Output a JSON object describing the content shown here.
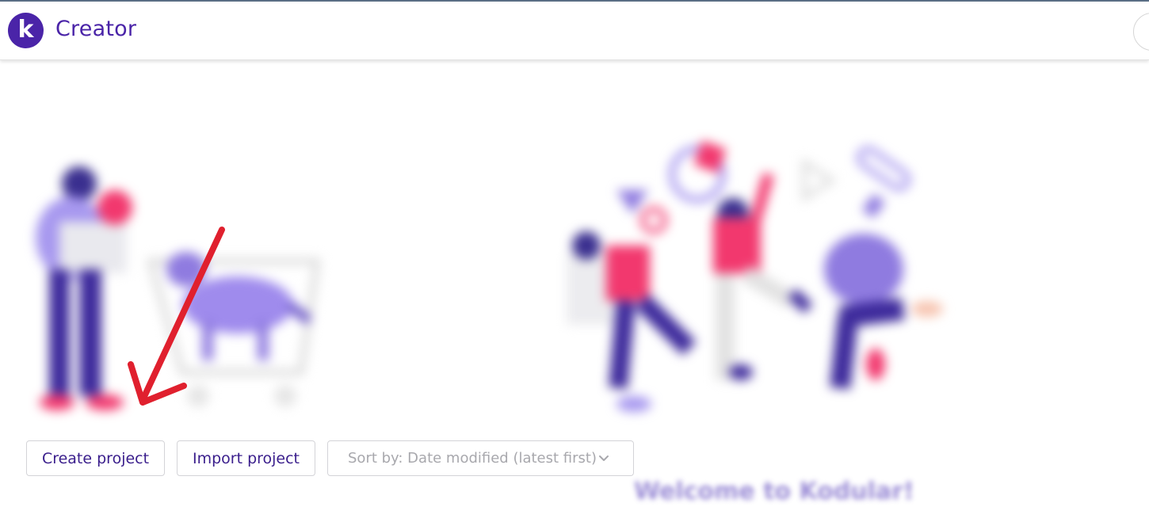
{
  "header": {
    "logo_letter": "k",
    "title": "Creator"
  },
  "actions": {
    "create_label": "Create project",
    "import_label": "Import project",
    "sort_label": "Sort by: Date modified (latest first)"
  },
  "welcome_text": "Welcome to Kodular!",
  "icons": {
    "logo": "kodular-logo-icon",
    "sort_chevron": "chevron-down-icon",
    "annotation": "red-arrow-icon"
  },
  "colors": {
    "brand": "#4a24a8",
    "accent_pink": "#f2386e",
    "accent_lavender": "#8f7be0",
    "annotation_red": "#e0202e"
  }
}
